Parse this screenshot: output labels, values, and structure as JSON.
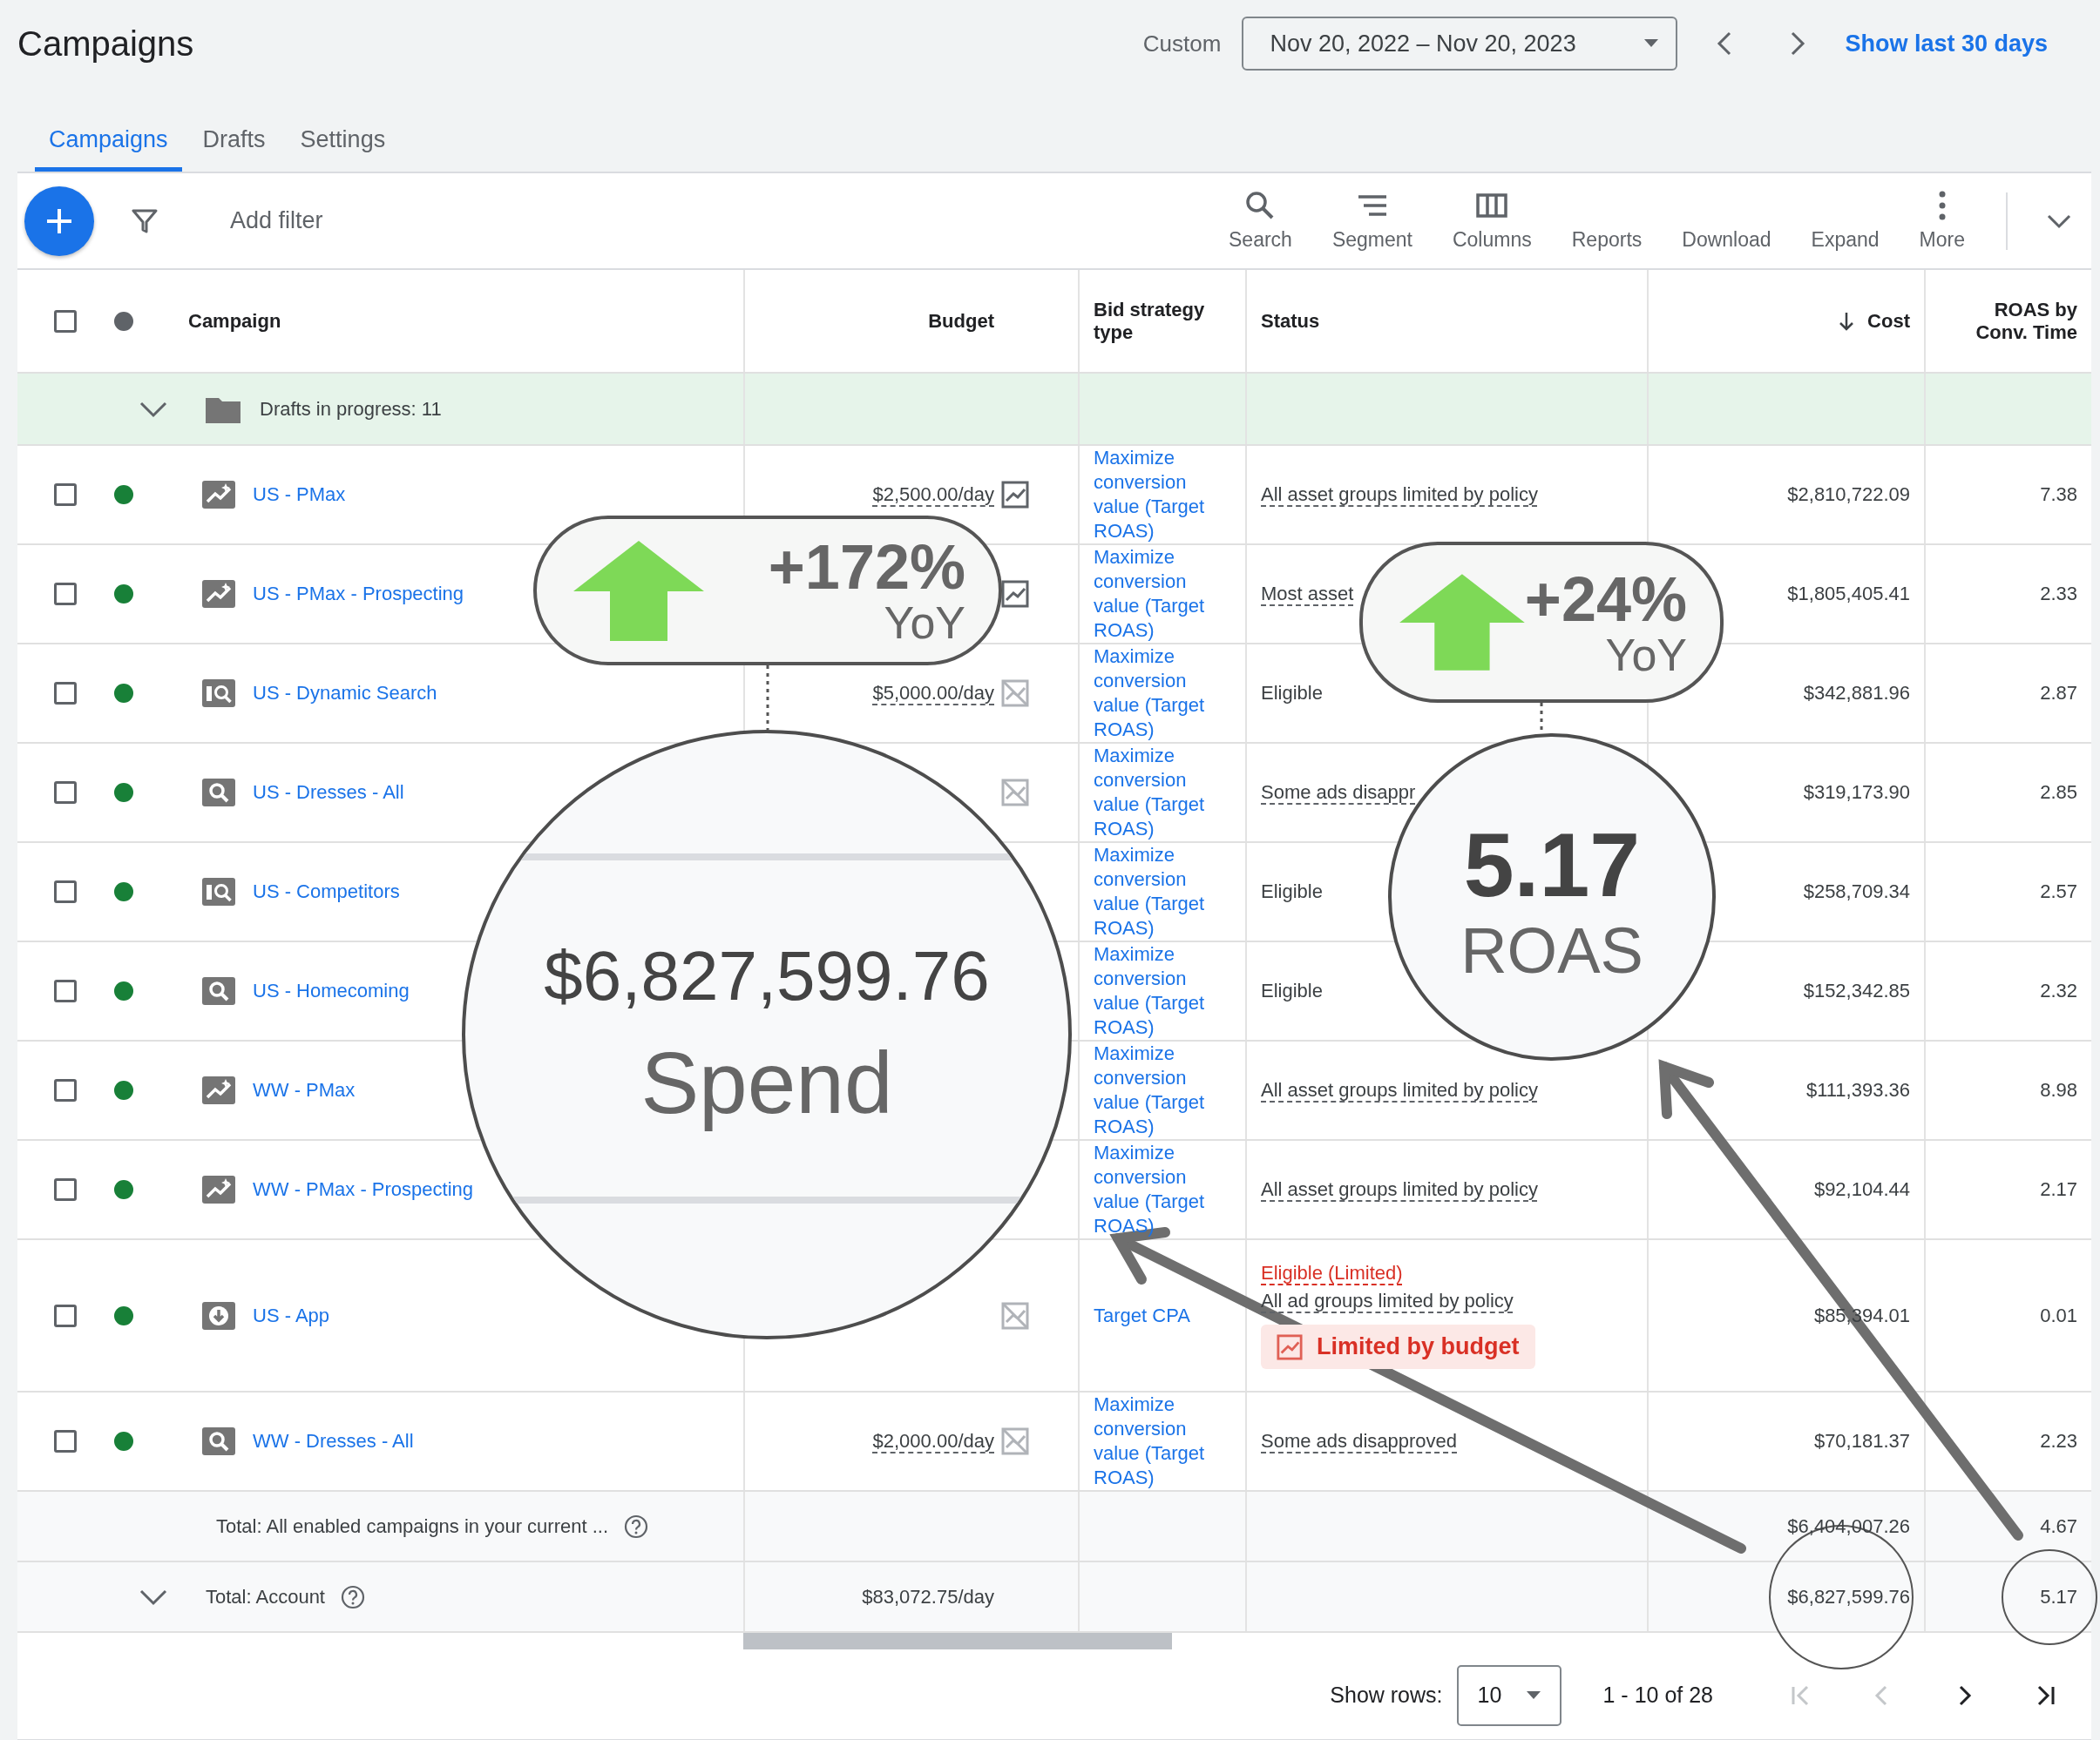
{
  "header": {
    "title": "Campaigns",
    "range_label": "Custom",
    "date_range": "Nov 20, 2022 – Nov 20, 2023",
    "quick_link": "Show last 30 days"
  },
  "tabs": [
    {
      "label": "Campaigns",
      "selected": true
    },
    {
      "label": "Drafts",
      "selected": false
    },
    {
      "label": "Settings",
      "selected": false
    }
  ],
  "toolbar": {
    "filter_placeholder": "Add filter",
    "actions": [
      {
        "label": "Search",
        "kind": "search"
      },
      {
        "label": "Segment",
        "kind": "segment"
      },
      {
        "label": "Columns",
        "kind": "columns"
      },
      {
        "label": "Reports",
        "kind": "text"
      },
      {
        "label": "Download",
        "kind": "text"
      },
      {
        "label": "Expand",
        "kind": "text"
      },
      {
        "label": "More",
        "kind": "more"
      }
    ]
  },
  "table": {
    "header_checkbox": {
      "checked": false
    },
    "columns": [
      {
        "label": "Campaign"
      },
      {
        "label": "Budget"
      },
      {
        "label": "Bid strategy type"
      },
      {
        "label": "Status"
      },
      {
        "label": "Cost",
        "sorted_desc": true
      },
      {
        "label": "ROAS by Conv. Time"
      }
    ],
    "drafts_row": {
      "label": "Drafts in progress: 11"
    },
    "rows": [
      {
        "checked": false,
        "enabled": true,
        "kind": "pmax",
        "name": "US - PMax",
        "budget": "$2,500.00/day",
        "budget_icon": {
          "crossed": false
        },
        "bid_strategy": "Maximize conversion value (Target ROAS)",
        "status": [
          {
            "text": "All asset groups limited by policy",
            "kind": "dashed"
          }
        ],
        "cost": "$2,810,722.09",
        "roas": "7.38"
      },
      {
        "checked": false,
        "enabled": true,
        "kind": "pmax",
        "name": "US - PMax - Prospecting",
        "budget_icon": {
          "crossed": false
        },
        "bid_strategy": "Maximize conversion value (Target ROAS)",
        "status": [
          {
            "text": "Most asset",
            "kind": "dashed"
          }
        ],
        "cost": "$1,805,405.41",
        "roas": "2.33"
      },
      {
        "checked": false,
        "enabled": true,
        "kind": "dynamic",
        "name": "US - Dynamic Search",
        "budget": "$5,000.00/day",
        "budget_icon": {
          "crossed": true
        },
        "bid_strategy": "Maximize conversion value (Target ROAS)",
        "status": [
          {
            "text": "Eligible",
            "kind": "plain"
          }
        ],
        "cost": "$342,881.96",
        "roas": "2.87"
      },
      {
        "checked": false,
        "enabled": true,
        "kind": "search",
        "name": "US - Dresses - All",
        "budget_icon": {
          "crossed": true
        },
        "bid_strategy": "Maximize conversion value (Target ROAS)",
        "status": [
          {
            "text": "Some ads disappr",
            "kind": "dashed"
          }
        ],
        "cost": "$319,173.90",
        "roas": "2.85"
      },
      {
        "checked": false,
        "enabled": true,
        "kind": "dynamic",
        "name": "US - Competitors",
        "bid_strategy": "Maximize conversion value (Target ROAS)",
        "status": [
          {
            "text": "Eligible",
            "kind": "plain"
          }
        ],
        "cost": "$258,709.34",
        "roas": "2.57"
      },
      {
        "checked": false,
        "enabled": true,
        "kind": "search",
        "name": "US - Homecoming",
        "bid_strategy": "Maximize conversion value (Target ROAS)",
        "status": [
          {
            "text": "Eligible",
            "kind": "plain"
          }
        ],
        "cost": "$152,342.85",
        "roas": "2.32"
      },
      {
        "checked": false,
        "enabled": true,
        "kind": "pmax",
        "name": "WW - PMax",
        "bid_strategy": "Maximize conversion value (Target ROAS)",
        "status": [
          {
            "text": "All asset groups limited by policy",
            "kind": "dashed"
          }
        ],
        "cost": "$111,393.36",
        "roas": "8.98"
      },
      {
        "checked": false,
        "enabled": true,
        "kind": "pmax",
        "name": "WW - PMax - Prospecting",
        "bid_strategy": "Maximize conversion value (Target ROAS)",
        "status": [
          {
            "text": "All asset groups limited by policy",
            "kind": "dashed"
          }
        ],
        "cost": "$92,104.44",
        "roas": "2.17"
      },
      {
        "checked": false,
        "enabled": true,
        "kind": "app",
        "name": "US - App",
        "budget_icon": {
          "crossed": true
        },
        "bid_strategy": "Target CPA",
        "status": [
          {
            "text": "Eligible (Limited)",
            "kind": "warning"
          },
          {
            "text": "All ad groups limited by policy",
            "kind": "dashed"
          },
          {
            "text": "Limited by budget",
            "kind": "chip"
          }
        ],
        "cost": "$85,394.01",
        "roas": "0.01"
      },
      {
        "checked": false,
        "enabled": true,
        "kind": "search",
        "name": "WW - Dresses - All",
        "budget": "$2,000.00/day",
        "budget_icon": {
          "crossed": true
        },
        "bid_strategy": "Maximize conversion value (Target ROAS)",
        "status": [
          {
            "text": "Some ads disapproved",
            "kind": "dashed"
          }
        ],
        "cost": "$70,181.37",
        "roas": "2.23"
      }
    ],
    "totals": [
      {
        "label": "Total: All enabled campaigns in your current ...",
        "expandable": false,
        "cost": "$6,404,007.26",
        "roas": "4.67"
      },
      {
        "label": "Total: Account",
        "expandable": true,
        "budget": "$83,072.75/day",
        "cost": "$6,827,599.76",
        "roas": "5.17"
      }
    ]
  },
  "footer": {
    "rows_label": "Show rows:",
    "rows_value": "10",
    "range": "1 - 10 of 28",
    "pager": [
      {
        "kind": "first",
        "disabled": true
      },
      {
        "kind": "prev",
        "disabled": true
      },
      {
        "kind": "next",
        "disabled": false
      },
      {
        "kind": "last",
        "disabled": false
      }
    ]
  },
  "callouts": [
    {
      "value": "+172%",
      "caption": "YoY"
    },
    {
      "value": "+24%",
      "caption": "YoY"
    }
  ],
  "magnifiers": [
    {
      "value": "$6,827,599.76",
      "caption": "Spend"
    },
    {
      "value": "5.17",
      "caption": "ROAS"
    }
  ]
}
